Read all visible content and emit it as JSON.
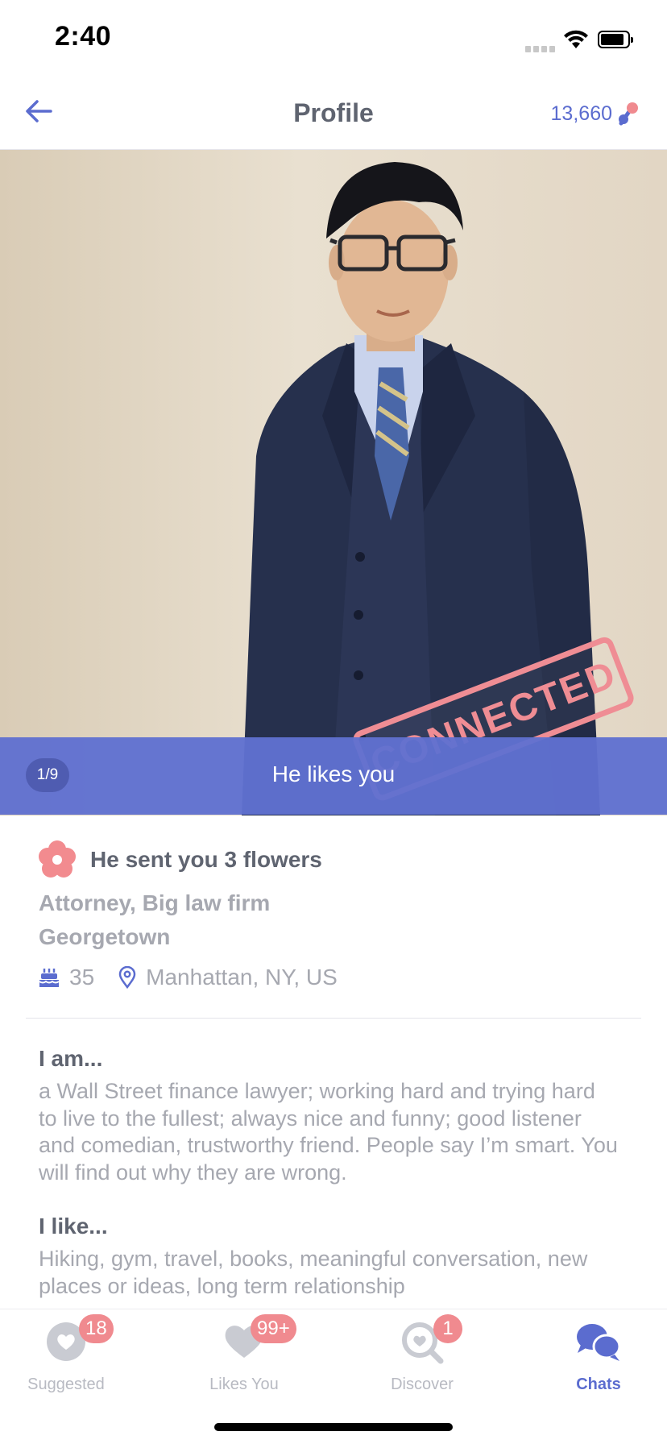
{
  "status_bar": {
    "time": "2:40"
  },
  "nav": {
    "title": "Profile",
    "coins": "13,660"
  },
  "photo": {
    "stamp_text": "CONNECTED",
    "counter": "1/9",
    "banner_text": "He likes you"
  },
  "profile": {
    "flowers_text": "He sent you 3 flowers",
    "job": "Attorney, Big law firm",
    "school": "Georgetown",
    "age": "35",
    "location": "Manhattan, NY, US"
  },
  "sections": [
    {
      "heading": "I am...",
      "body": "a Wall Street finance lawyer; working hard and trying hard to live to the fullest; always nice and funny; good listener and comedian, trustworthy friend.  People say I’m smart. You will find out why they are wrong."
    },
    {
      "heading": "I like...",
      "body": "Hiking, gym, travel, books, meaningful conversation, new places or ideas, long term relationship"
    }
  ],
  "tabs": [
    {
      "label": "Suggested",
      "badge": "18",
      "icon": "heart-circle-icon"
    },
    {
      "label": "Likes You",
      "badge": "99+",
      "icon": "heart-icon"
    },
    {
      "label": "Discover",
      "badge": "1",
      "icon": "search-heart-icon"
    },
    {
      "label": "Chats",
      "badge": "",
      "icon": "chat-bubbles-icon"
    }
  ],
  "colors": {
    "accent": "#5b6ccf",
    "banner": "#6070d0",
    "badge": "#f08a8f",
    "stamp": "#ef8d94",
    "muted_text": "#a6a8b0",
    "dark_text": "#5f6470"
  }
}
